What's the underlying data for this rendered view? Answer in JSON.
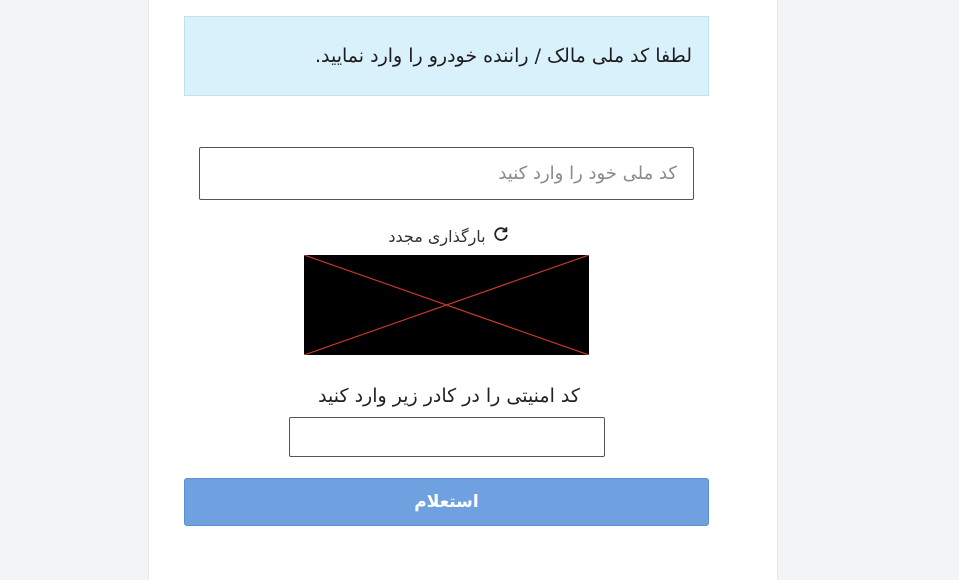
{
  "alert": {
    "message": "لطفا کد ملی مالک / راننده خودرو را وارد نمایید."
  },
  "national_id": {
    "placeholder": "کد ملی خود را وارد کنید",
    "value": ""
  },
  "captcha": {
    "reload_label": "بارگذاری مجدد",
    "reload_icon": "refresh-icon",
    "image_icon": "broken-image-icon",
    "cross_color": "#c0392b"
  },
  "security_code": {
    "label": "کد امنیتی را در کادر زیر وارد کنید",
    "value": ""
  },
  "submit": {
    "label": "استعلام",
    "color": "#6fa1e0"
  }
}
